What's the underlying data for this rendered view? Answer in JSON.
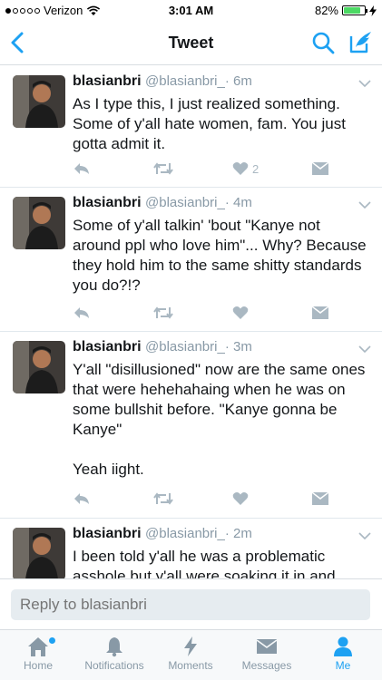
{
  "status": {
    "carrier": "Verizon",
    "time": "3:01 AM",
    "battery_pct": "82%",
    "battery_level": 0.82
  },
  "nav": {
    "title": "Tweet"
  },
  "tweets": [
    {
      "author": "blasianbri",
      "handle": "@blasianbri_",
      "time": "· 6m",
      "text": "As I type this, I just realized something. Some of y'all hate women, fam. You just gotta admit it.",
      "likes": "2"
    },
    {
      "author": "blasianbri",
      "handle": "@blasianbri_",
      "time": "· 4m",
      "text": "Some of y'all talkin' 'bout \"Kanye not around ppl who love him\"... Why? Because they hold him to the same shitty standards you do?!?",
      "likes": ""
    },
    {
      "author": "blasianbri",
      "handle": "@blasianbri_",
      "time": "· 3m",
      "text": "Y'all \"disillusioned\" now are the same ones that were hehehahaing when he was on some bullshit before. \"Kanye gonna be Kanye\"\n\nYeah iight.",
      "likes": ""
    },
    {
      "author": "blasianbri",
      "handle": "@blasianbri_",
      "time": "· 2m",
      "text": "I been told y'all he was a problematic asshole but y'all were soaking it in and",
      "likes": ""
    }
  ],
  "reply": {
    "placeholder": "Reply to blasianbri"
  },
  "tabs": {
    "home": "Home",
    "notifications": "Notifications",
    "moments": "Moments",
    "messages": "Messages",
    "me": "Me"
  },
  "colors": {
    "accent": "#1da1f2",
    "muted": "#aab8c2",
    "battery": "#4cd964"
  },
  "icons": [
    "back-arrow-icon",
    "search-icon",
    "compose-icon",
    "reply-icon",
    "retweet-icon",
    "like-icon",
    "direct-message-icon",
    "caret-down-icon",
    "home-icon",
    "bell-icon",
    "lightning-icon",
    "envelope-icon",
    "person-icon"
  ]
}
